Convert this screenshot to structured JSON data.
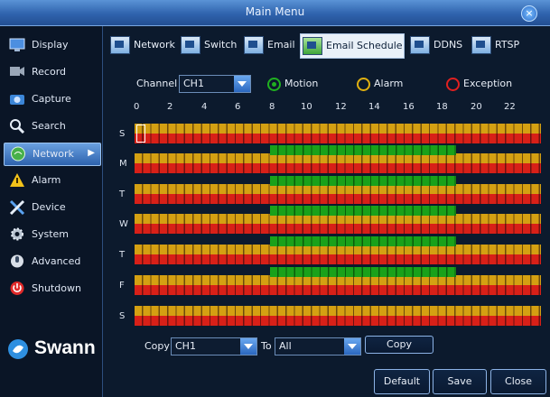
{
  "window": {
    "title": "Main Menu"
  },
  "sidebar": {
    "items": [
      {
        "label": "Display"
      },
      {
        "label": "Record"
      },
      {
        "label": "Capture"
      },
      {
        "label": "Search"
      },
      {
        "label": "Network",
        "active": true
      },
      {
        "label": "Alarm"
      },
      {
        "label": "Device"
      },
      {
        "label": "System"
      },
      {
        "label": "Advanced"
      },
      {
        "label": "Shutdown"
      }
    ],
    "brand": "Swann"
  },
  "tabs": [
    {
      "label": "Network"
    },
    {
      "label": "Switch"
    },
    {
      "label": "Email"
    },
    {
      "label": "Email Schedule",
      "active": true
    },
    {
      "label": "DDNS"
    },
    {
      "label": "RTSP"
    }
  ],
  "schedule": {
    "channel_label": "Channel",
    "channel_value": "CH1",
    "legend": [
      {
        "label": "Motion",
        "color": "#20b020"
      },
      {
        "label": "Alarm",
        "color": "#e0b010"
      },
      {
        "label": "Exception",
        "color": "#e02020"
      }
    ],
    "hours": [
      "0",
      "2",
      "4",
      "6",
      "8",
      "10",
      "12",
      "14",
      "16",
      "18",
      "20",
      "22"
    ],
    "days": [
      "S",
      "M",
      "T",
      "W",
      "T",
      "F",
      "S"
    ],
    "motion_weekdays_hours": [
      8,
      19
    ]
  },
  "copy": {
    "copy_label": "Copy",
    "from_value": "CH1",
    "to_label": "To",
    "to_value": "All",
    "copy_button": "Copy"
  },
  "footer": {
    "default_button": "Default",
    "save_button": "Save",
    "close_button": "Close"
  },
  "colors": {
    "motion": "#19a11a",
    "alarm": "#d4a012",
    "exception": "#d82018",
    "accent": "#2f63ad"
  }
}
